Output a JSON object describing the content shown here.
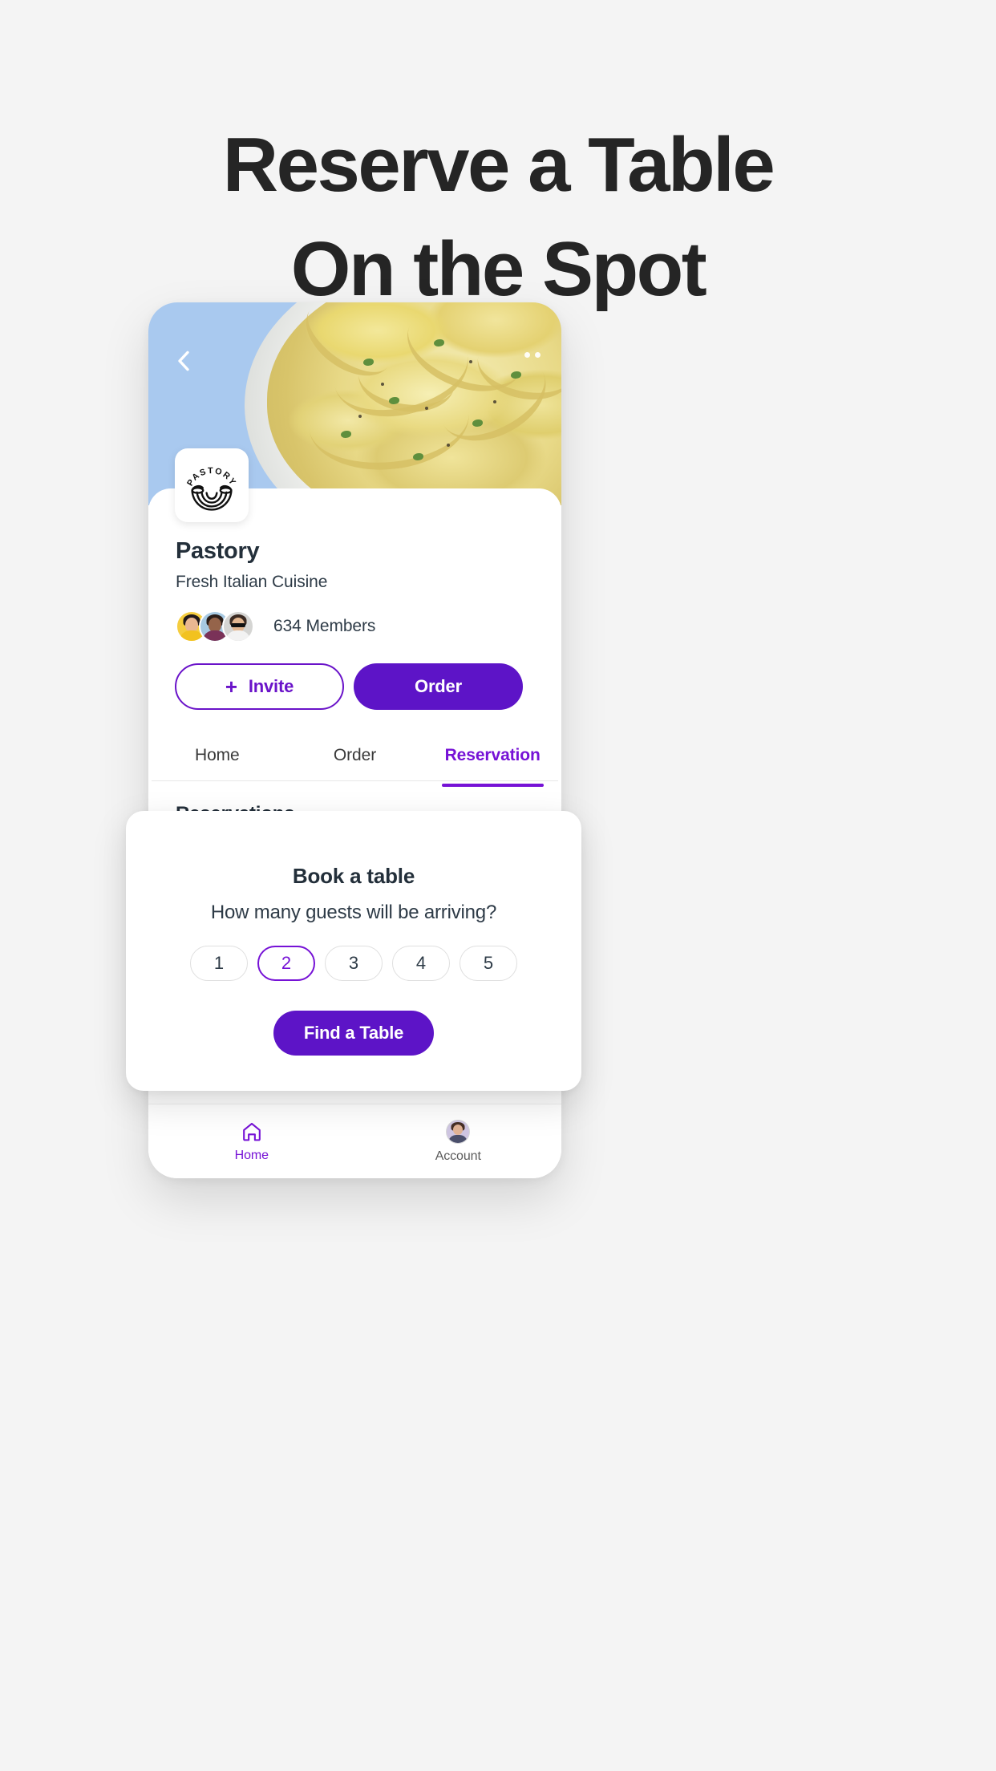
{
  "headline": {
    "line1": "Reserve a Table",
    "line2": "On the Spot"
  },
  "phone": {
    "hero": {
      "back_icon": "chevron-left-icon",
      "more_icon": "more-options-icon",
      "background_color": "#a9c9ef"
    },
    "logo": {
      "brand_text": "PASTORY",
      "mark": "pasta-bowl-icon"
    },
    "restaurant": {
      "name": "Pastory",
      "subtitle": "Fresh Italian Cuisine",
      "members_count": "634 Members"
    },
    "actions": {
      "invite_label": "Invite",
      "invite_plus": "+",
      "order_label": "Order"
    },
    "tabs": [
      {
        "label": "Home",
        "active": false
      },
      {
        "label": "Order",
        "active": false
      },
      {
        "label": "Reservation",
        "active": true
      }
    ],
    "section_title": "Reservations",
    "bottom_nav": [
      {
        "label": "Home",
        "icon": "home-icon",
        "active": true
      },
      {
        "label": "Account",
        "icon": "account-avatar-icon",
        "active": false
      }
    ]
  },
  "modal": {
    "title": "Book a table",
    "question": "How many guests will be arriving?",
    "guest_options": [
      "1",
      "2",
      "3",
      "4",
      "5"
    ],
    "selected_guests": "2",
    "cta_label": "Find a Table"
  },
  "colors": {
    "accent_purple": "#5d14c7",
    "accent_purple_bright": "#7612d6",
    "page_background": "#f4f4f4",
    "heading_dark": "#252525",
    "text_navy": "#232f3a"
  }
}
